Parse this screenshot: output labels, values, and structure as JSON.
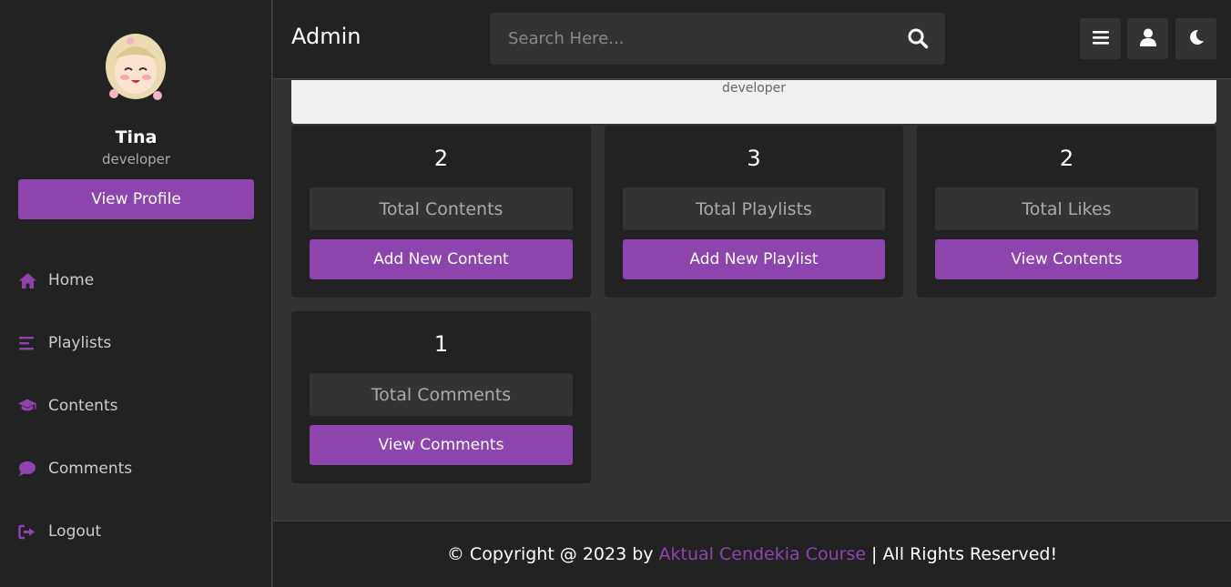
{
  "header": {
    "brand": "Admin",
    "search_placeholder": "Search Here..."
  },
  "sidebar": {
    "profile_name": "Tina",
    "profile_role": "developer",
    "view_profile_label": "View Profile",
    "items": [
      {
        "label": "Home",
        "icon": "home-icon"
      },
      {
        "label": "Playlists",
        "icon": "bars-icon"
      },
      {
        "label": "Contents",
        "icon": "graduation-cap-icon"
      },
      {
        "label": "Comments",
        "icon": "comment-icon"
      },
      {
        "label": "Logout",
        "icon": "logout-icon"
      }
    ]
  },
  "profile_strip": {
    "role": "developer"
  },
  "cards": [
    {
      "count": "2",
      "label": "Total Contents",
      "action": "Add New Content"
    },
    {
      "count": "3",
      "label": "Total Playlists",
      "action": "Add New Playlist"
    },
    {
      "count": "2",
      "label": "Total Likes",
      "action": "View Contents"
    },
    {
      "count": "1",
      "label": "Total Comments",
      "action": "View Comments"
    }
  ],
  "footer": {
    "prefix": "© Copyright @ 2023 by",
    "link": "Aktual Cendekia Course",
    "suffix": "| All Rights Reserved!"
  },
  "colors": {
    "accent": "#8e44ad",
    "panel": "#222222",
    "background": "#333333"
  }
}
